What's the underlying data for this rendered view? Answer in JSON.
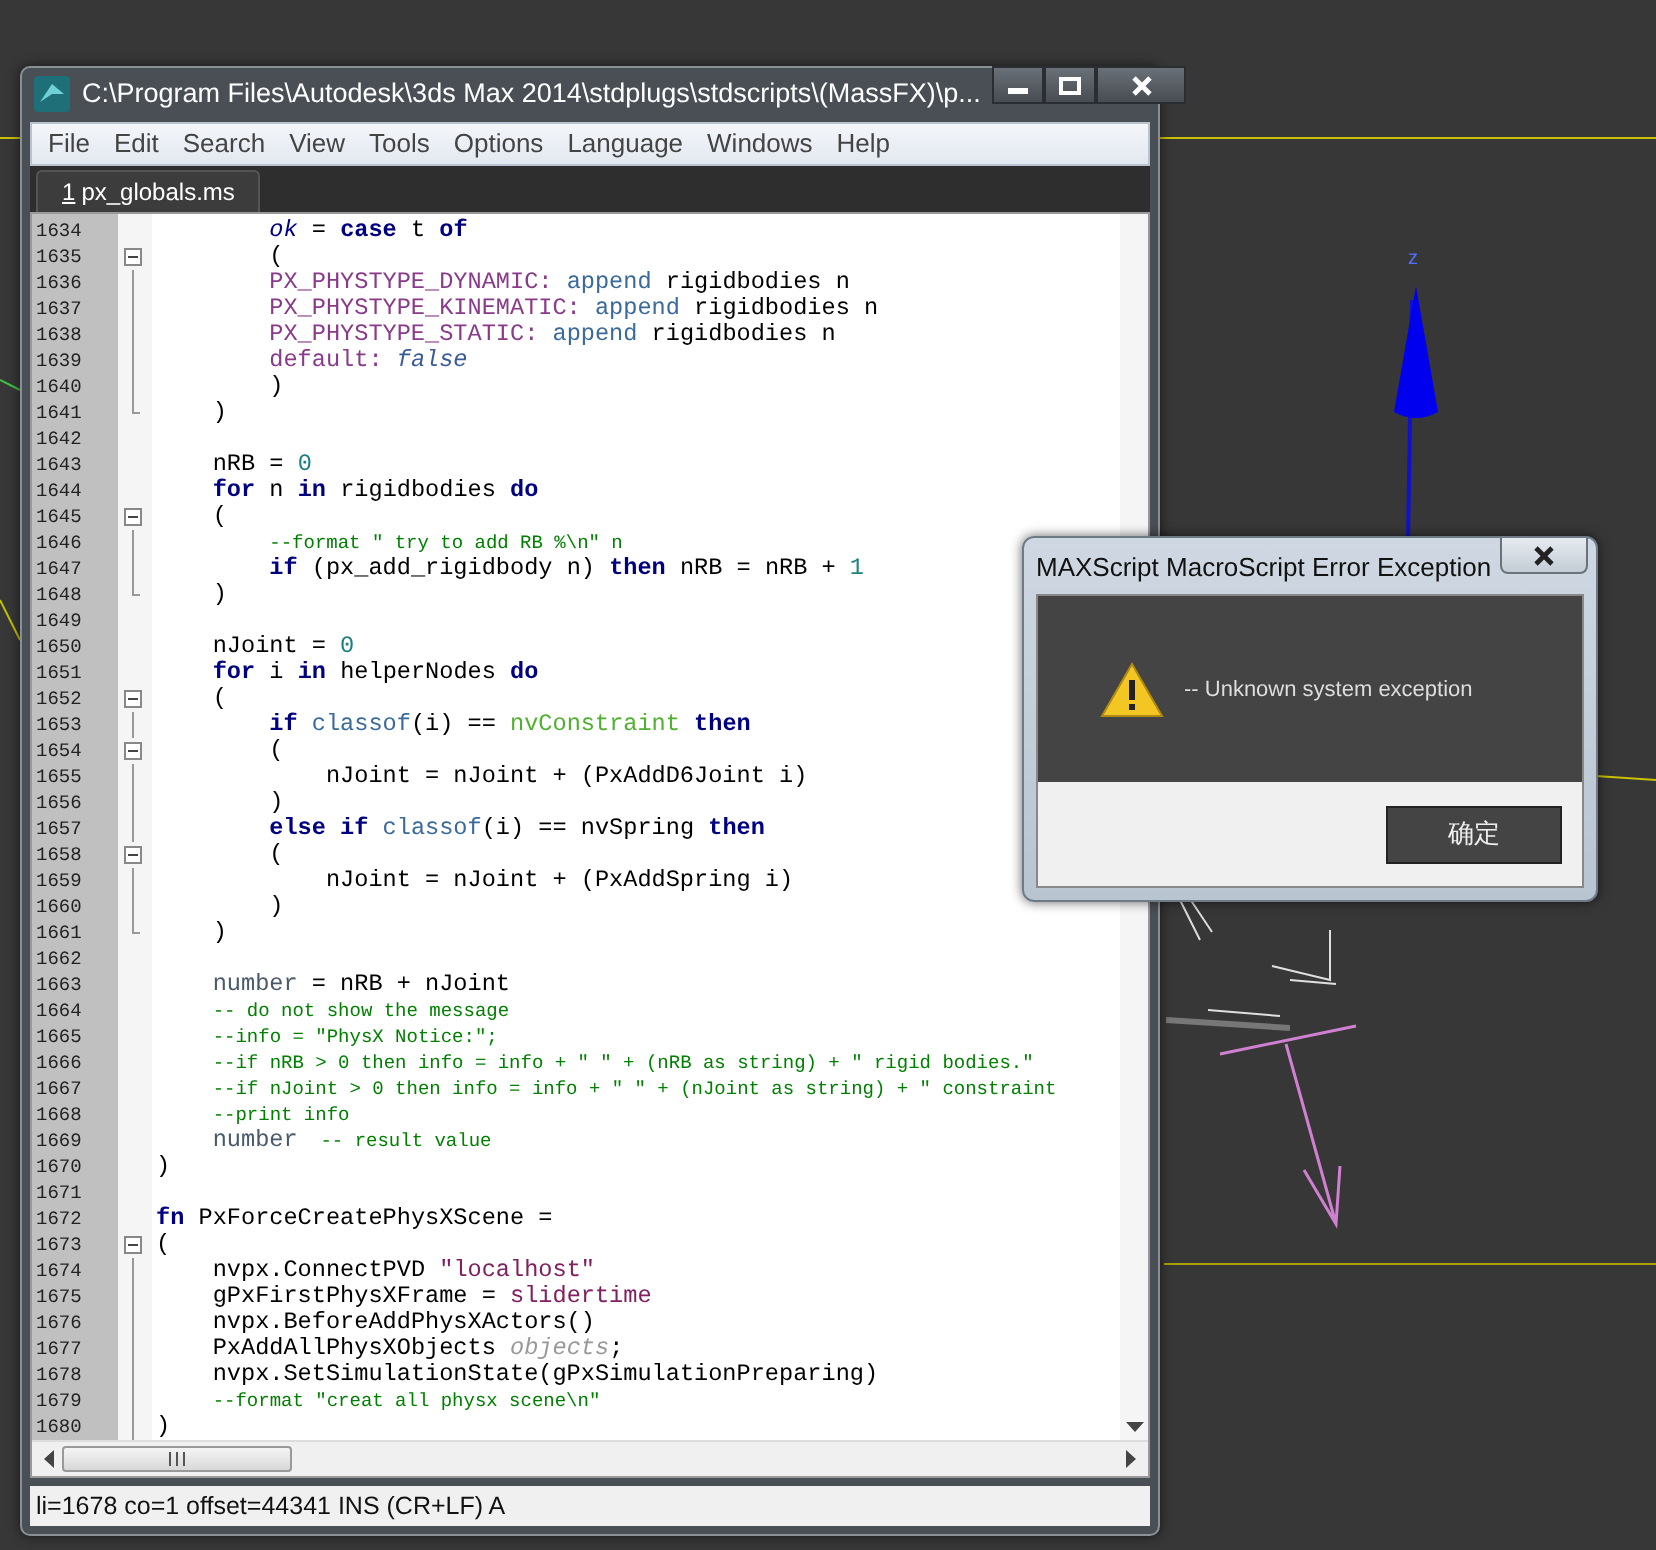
{
  "viewport": {
    "axis_label": "z"
  },
  "window": {
    "title": "C:\\Program Files\\Autodesk\\3ds Max 2014\\stdplugs\\stdscripts\\(MassFX)\\p...",
    "menu": [
      "File",
      "Edit",
      "Search",
      "View",
      "Tools",
      "Options",
      "Language",
      "Windows",
      "Help"
    ],
    "tabs": [
      {
        "number": "1",
        "label": "px_globals.ms",
        "selected": true
      }
    ],
    "lines": [
      {
        "no": "1634",
        "segs": [
          {
            "kind": "var",
            "t": "        ok"
          },
          {
            "kind": "plain",
            "t": " = "
          },
          {
            "kind": "kw",
            "t": "case"
          },
          {
            "kind": "plain",
            "t": " t "
          },
          {
            "kind": "kw",
            "t": "of"
          }
        ]
      },
      {
        "no": "1635",
        "fold": {
          "kind": "box"
        },
        "segs": [
          {
            "kind": "plain",
            "t": "        ("
          }
        ]
      },
      {
        "no": "1636",
        "fold": {
          "kind": "line"
        },
        "segs": [
          {
            "kind": "const",
            "t": "        PX_PHYSTYPE_DYNAMIC:"
          },
          {
            "kind": "fn",
            "t": " append"
          },
          {
            "kind": "plain",
            "t": " rigidbodies n"
          }
        ]
      },
      {
        "no": "1637",
        "fold": {
          "kind": "line"
        },
        "segs": [
          {
            "kind": "const",
            "t": "        PX_PHYSTYPE_KINEMATIC:"
          },
          {
            "kind": "fn",
            "t": " append"
          },
          {
            "kind": "plain",
            "t": " rigidbodies n"
          }
        ]
      },
      {
        "no": "1638",
        "fold": {
          "kind": "line"
        },
        "segs": [
          {
            "kind": "const",
            "t": "        PX_PHYSTYPE_STATIC:"
          },
          {
            "kind": "fn",
            "t": " append"
          },
          {
            "kind": "plain",
            "t": " rigidbodies n"
          }
        ]
      },
      {
        "no": "1639",
        "fold": {
          "kind": "line"
        },
        "segs": [
          {
            "kind": "const",
            "t": "        default:"
          },
          {
            "kind": "lit",
            "t": " false"
          }
        ]
      },
      {
        "no": "1640",
        "fold": {
          "kind": "line"
        },
        "segs": [
          {
            "kind": "plain",
            "t": "        )"
          }
        ]
      },
      {
        "no": "1641",
        "fold": {
          "kind": "end"
        },
        "segs": [
          {
            "kind": "plain",
            "t": "    )"
          }
        ]
      },
      {
        "no": "1642"
      },
      {
        "no": "1643",
        "segs": [
          {
            "kind": "plain",
            "t": "    nRB = "
          },
          {
            "kind": "num",
            "t": "0"
          }
        ]
      },
      {
        "no": "1644",
        "segs": [
          {
            "kind": "kw",
            "t": "    for"
          },
          {
            "kind": "plain",
            "t": " n "
          },
          {
            "kind": "kw",
            "t": "in"
          },
          {
            "kind": "plain",
            "t": " rigidbodies "
          },
          {
            "kind": "kw",
            "t": "do"
          }
        ]
      },
      {
        "no": "1645",
        "fold": {
          "kind": "box"
        },
        "segs": [
          {
            "kind": "plain",
            "t": "    ("
          }
        ]
      },
      {
        "no": "1646",
        "fold": {
          "kind": "line"
        },
        "segs": [
          {
            "kind": "cmt",
            "t": "        --format \" try to add RB %\\n\" n"
          }
        ]
      },
      {
        "no": "1647",
        "fold": {
          "kind": "line"
        },
        "segs": [
          {
            "kind": "kw",
            "t": "        if"
          },
          {
            "kind": "plain",
            "t": " (px_add_rigidbody n) "
          },
          {
            "kind": "kw",
            "t": "then"
          },
          {
            "kind": "plain",
            "t": " nRB = nRB + "
          },
          {
            "kind": "num",
            "t": "1"
          }
        ]
      },
      {
        "no": "1648",
        "fold": {
          "kind": "end"
        },
        "segs": [
          {
            "kind": "plain",
            "t": "    )"
          }
        ]
      },
      {
        "no": "1649"
      },
      {
        "no": "1650",
        "segs": [
          {
            "kind": "plain",
            "t": "    nJoint = "
          },
          {
            "kind": "num",
            "t": "0"
          }
        ]
      },
      {
        "no": "1651",
        "segs": [
          {
            "kind": "kw",
            "t": "    for"
          },
          {
            "kind": "plain",
            "t": " i "
          },
          {
            "kind": "kw",
            "t": "in"
          },
          {
            "kind": "plain",
            "t": " helperNodes "
          },
          {
            "kind": "kw",
            "t": "do"
          }
        ]
      },
      {
        "no": "1652",
        "fold": {
          "kind": "box"
        },
        "segs": [
          {
            "kind": "plain",
            "t": "    ("
          }
        ]
      },
      {
        "no": "1653",
        "fold": {
          "kind": "line"
        },
        "segs": [
          {
            "kind": "kw",
            "t": "        if"
          },
          {
            "kind": "fn",
            "t": " classof"
          },
          {
            "kind": "plain",
            "t": "(i) == "
          },
          {
            "kind": "cls",
            "t": "nvConstraint"
          },
          {
            "kind": "kw",
            "t": " then"
          }
        ]
      },
      {
        "no": "1654",
        "fold": {
          "kind": "box"
        },
        "segs": [
          {
            "kind": "plain",
            "t": "        ("
          }
        ]
      },
      {
        "no": "1655",
        "fold": {
          "kind": "line"
        },
        "segs": [
          {
            "kind": "plain",
            "t": "            nJoint = nJoint + (PxAddD6Joint i)"
          }
        ]
      },
      {
        "no": "1656",
        "fold": {
          "kind": "line"
        },
        "segs": [
          {
            "kind": "plain",
            "t": "        )"
          }
        ]
      },
      {
        "no": "1657",
        "fold": {
          "kind": "line"
        },
        "segs": [
          {
            "kind": "kw",
            "t": "        else if"
          },
          {
            "kind": "fn",
            "t": " classof"
          },
          {
            "kind": "plain",
            "t": "(i) == nvSpring "
          },
          {
            "kind": "kw",
            "t": "then"
          }
        ]
      },
      {
        "no": "1658",
        "fold": {
          "kind": "box"
        },
        "segs": [
          {
            "kind": "plain",
            "t": "        ("
          }
        ]
      },
      {
        "no": "1659",
        "fold": {
          "kind": "line"
        },
        "segs": [
          {
            "kind": "plain",
            "t": "            nJoint = nJoint + (PxAddSpring i)"
          }
        ]
      },
      {
        "no": "1660",
        "fold": {
          "kind": "line"
        },
        "segs": [
          {
            "kind": "plain",
            "t": "        )"
          }
        ]
      },
      {
        "no": "1661",
        "fold": {
          "kind": "end"
        },
        "segs": [
          {
            "kind": "plain",
            "t": "    )"
          }
        ]
      },
      {
        "no": "1662"
      },
      {
        "no": "1663",
        "segs": [
          {
            "kind": "dim",
            "t": "    number"
          },
          {
            "kind": "plain",
            "t": " = nRB + nJoint"
          }
        ]
      },
      {
        "no": "1664",
        "segs": [
          {
            "kind": "cmt",
            "t": "    -- do not show the message"
          }
        ]
      },
      {
        "no": "1665",
        "segs": [
          {
            "kind": "cmt",
            "t": "    --info = \"PhysX Notice:\";"
          }
        ]
      },
      {
        "no": "1666",
        "segs": [
          {
            "kind": "cmt",
            "t": "    --if nRB > 0 then info = info + \" \" + (nRB as string) + \" rigid bodies.\""
          }
        ]
      },
      {
        "no": "1667",
        "segs": [
          {
            "kind": "cmt",
            "t": "    --if nJoint > 0 then info = info + \" \" + (nJoint as string) + \" constraint"
          }
        ]
      },
      {
        "no": "1668",
        "segs": [
          {
            "kind": "cmt",
            "t": "    --print info"
          }
        ]
      },
      {
        "no": "1669",
        "segs": [
          {
            "kind": "dim",
            "t": "    number"
          },
          {
            "kind": "cmt",
            "t": "  -- result value"
          }
        ]
      },
      {
        "no": "1670",
        "segs": [
          {
            "kind": "plain",
            "t": ")"
          }
        ]
      },
      {
        "no": "1671"
      },
      {
        "no": "1672",
        "segs": [
          {
            "kind": "kw",
            "t": "fn"
          },
          {
            "kind": "plain",
            "t": " PxForceCreatePhysXScene ="
          }
        ]
      },
      {
        "no": "1673",
        "fold": {
          "kind": "box"
        },
        "segs": [
          {
            "kind": "plain",
            "t": "("
          }
        ]
      },
      {
        "no": "1674",
        "fold": {
          "kind": "line"
        },
        "segs": [
          {
            "kind": "plain",
            "t": "    nvpx.ConnectPVD "
          },
          {
            "kind": "str",
            "t": "\"localhost\""
          }
        ]
      },
      {
        "no": "1675",
        "fold": {
          "kind": "line"
        },
        "segs": [
          {
            "kind": "plain",
            "t": "    gPxFirstPhysXFrame = "
          },
          {
            "kind": "str",
            "t": "slidertime"
          }
        ]
      },
      {
        "no": "1676",
        "fold": {
          "kind": "line"
        },
        "segs": [
          {
            "kind": "plain",
            "t": "    nvpx.BeforeAddPhysXActors()"
          }
        ]
      },
      {
        "no": "1677",
        "fold": {
          "kind": "line"
        },
        "segs": [
          {
            "kind": "plain",
            "t": "    PxAddAllPhysXObjects "
          },
          {
            "kind": "dimit",
            "t": "objects"
          },
          {
            "kind": "plain",
            "t": ";"
          }
        ]
      },
      {
        "no": "1678",
        "fold": {
          "kind": "line"
        },
        "segs": [
          {
            "kind": "plain",
            "t": "    nvpx.SetSimulationState(gPxSimulationPreparing)"
          }
        ]
      },
      {
        "no": "1679",
        "fold": {
          "kind": "line"
        },
        "segs": [
          {
            "kind": "cmt",
            "t": "    --format \"creat all physx scene\\n\""
          }
        ]
      },
      {
        "no": "1680",
        "fold": {
          "kind": "line"
        },
        "segs": [
          {
            "kind": "plain",
            "t": ")"
          }
        ]
      }
    ],
    "status_bar": "li=1678 co=1 offset=44341 INS (CR+LF) A"
  },
  "dialog": {
    "title": "MAXScript MacroScript Error Exception",
    "message": "-- Unknown system exception",
    "buttons": [
      "确定"
    ]
  }
}
